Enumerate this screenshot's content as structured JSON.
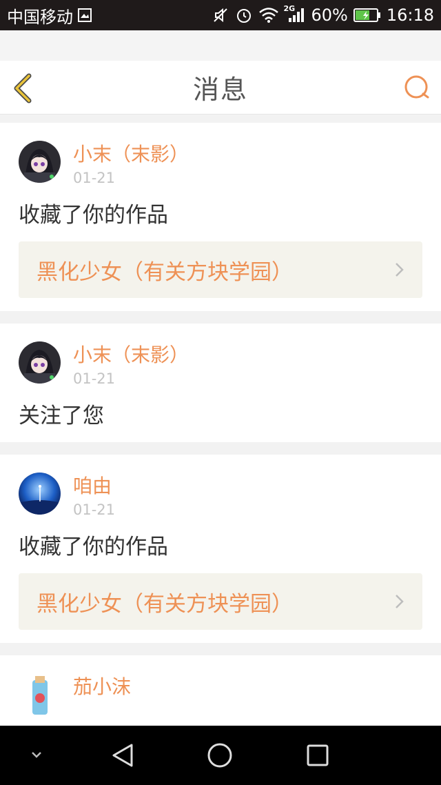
{
  "status_bar": {
    "carrier": "中国移动",
    "network": "2G",
    "battery": "60%",
    "time": "16:18"
  },
  "header": {
    "title": "消息",
    "back_icon": "chevron-left-icon",
    "search_icon": "search-icon"
  },
  "colors": {
    "accent": "#ee9155",
    "back_icon": "#e9c33a",
    "card_link_bg": "#f4f3ec"
  },
  "messages": [
    {
      "username": "小末（末影）",
      "date": "01-21",
      "action": "收藏了你的作品",
      "work_title": "黑化少女（有关方块学园）"
    },
    {
      "username": "小末（末影）",
      "date": "01-21",
      "action": "关注了您"
    },
    {
      "username": "咱由",
      "date": "01-21",
      "action": "收藏了你的作品",
      "work_title": "黑化少女（有关方块学园）"
    },
    {
      "username": "茄小沫"
    }
  ],
  "nav_bar": {
    "items": [
      "collapse-icon",
      "back-triangle-icon",
      "home-circle-icon",
      "recents-square-icon"
    ]
  }
}
